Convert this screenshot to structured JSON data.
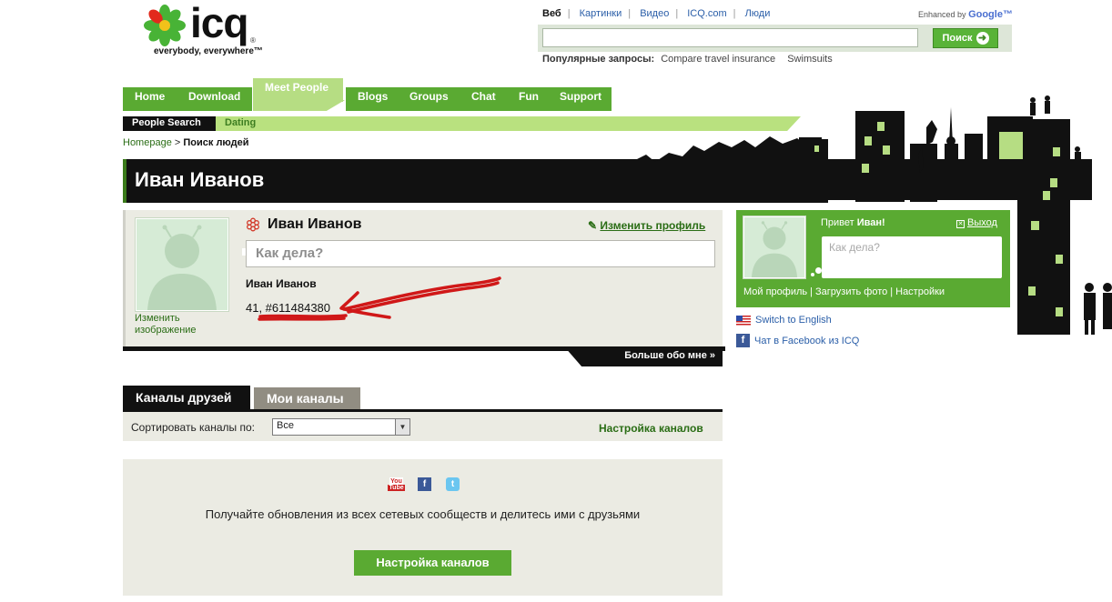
{
  "logo": {
    "word": "icq",
    "reg": "®",
    "tagline": "everybody, everywhere™"
  },
  "search": {
    "nav": [
      {
        "label": "Веб",
        "active": true
      },
      {
        "label": "Картинки"
      },
      {
        "label": "Видео"
      },
      {
        "label": "ICQ.com"
      },
      {
        "label": "Люди"
      }
    ],
    "enhanced_prefix": "Enhanced by",
    "enhanced_brand": "Google™",
    "value": "",
    "button_label": "Поиск",
    "popular_label": "Популярные запросы:",
    "popular": [
      "Compare travel insurance",
      "Swimsuits"
    ]
  },
  "tabs": [
    "Home",
    "Download",
    "Meet People",
    "Blogs",
    "Groups",
    "Chat",
    "Fun",
    "Support"
  ],
  "active_tab": "Meet People",
  "subnav": {
    "people_search": "People Search",
    "dating": "Dating"
  },
  "breadcrumb": {
    "home": "Homepage",
    "sep": " > ",
    "current": "Поиск людей"
  },
  "page_title": "Иван Иванов",
  "profile": {
    "name": "Иван Иванов",
    "edit_label": "Изменить профиль",
    "status_placeholder": "Как дела?",
    "change_image_line1": "Изменить",
    "change_image_line2": "изображение",
    "sub_name": "Иван Иванов",
    "age_uin": "41, #611484380",
    "more_about": "Больше обо мне »"
  },
  "channels": {
    "tab_friends": "Каналы друзей",
    "tab_mine": "Мои каналы",
    "sort_label": "Сортировать каналы по:",
    "sort_value": "Все",
    "settings_link": "Настройка каналов"
  },
  "updates": {
    "text": "Получайте обновления из всех сетевых сообществ и делитесь ими с друзьями",
    "button": "Настройка каналов",
    "icons": [
      "youtube-icon",
      "facebook-icon",
      "twitter-icon"
    ]
  },
  "widget": {
    "hello_prefix": "Привет ",
    "hello_name": "Иван!",
    "logout": "Выход",
    "status_placeholder": "Как дела?",
    "links": [
      "Мой профиль",
      "Загрузить фото",
      "Настройки"
    ]
  },
  "extra_links": {
    "english": "Switch to English",
    "facebook": "Чат в Facebook из ICQ"
  },
  "colors": {
    "accent": "#5aaa32",
    "light_accent": "#b6dd83",
    "annotation": "#d01818"
  }
}
